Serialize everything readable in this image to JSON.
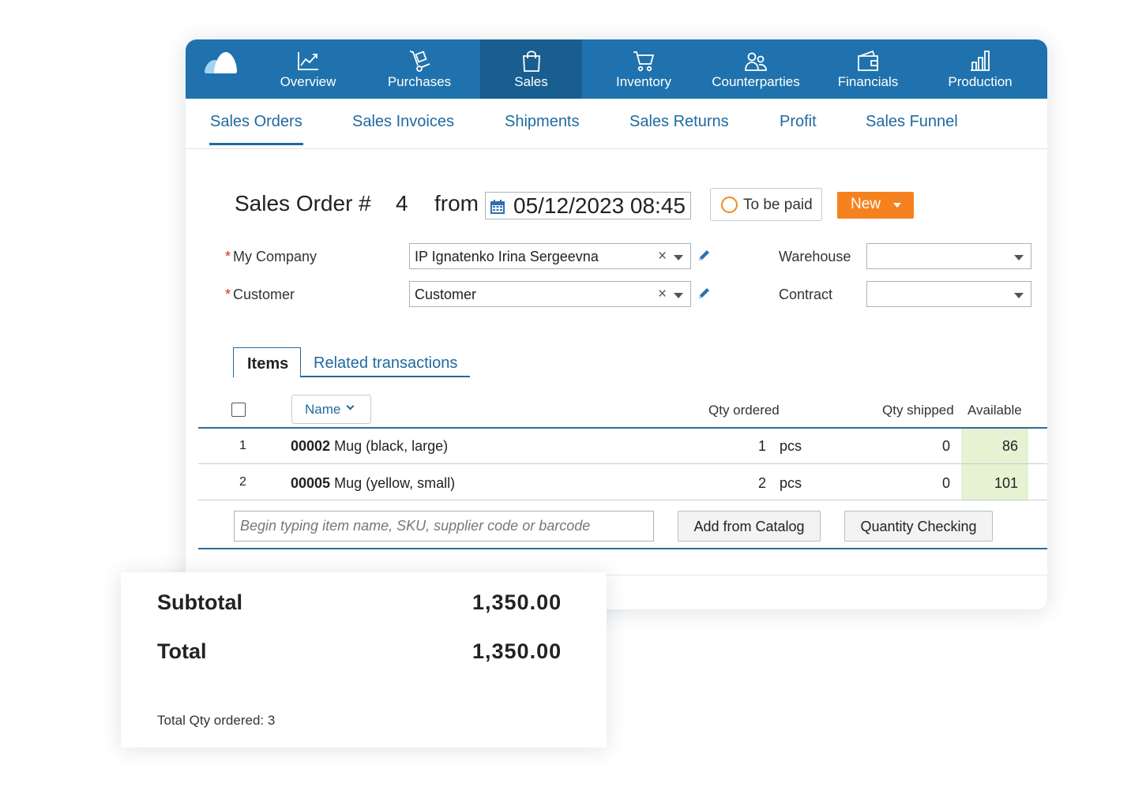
{
  "nav": {
    "items": [
      {
        "label": "Overview",
        "icon": "chart-line-icon"
      },
      {
        "label": "Purchases",
        "icon": "hand-truck-icon"
      },
      {
        "label": "Sales",
        "icon": "shopping-bag-icon",
        "active": true
      },
      {
        "label": "Inventory",
        "icon": "cart-icon"
      },
      {
        "label": "Counterparties",
        "icon": "users-icon"
      },
      {
        "label": "Financials",
        "icon": "wallet-icon"
      },
      {
        "label": "Production",
        "icon": "factory-icon"
      }
    ]
  },
  "subnav": {
    "items": [
      "Sales Orders",
      "Sales Invoices",
      "Shipments",
      "Sales Returns",
      "Profit",
      "Sales Funnel"
    ],
    "active": "Sales Orders"
  },
  "order": {
    "title": "Sales Order #",
    "number": "4",
    "from_label": "from",
    "date": "05/12/2023 08:45",
    "status_label": "To be paid",
    "state_label": "New"
  },
  "form": {
    "required_mark": "*",
    "my_company_label": "My Company",
    "my_company_value": "IP Ignatenko Irina Sergeevna",
    "customer_label": "Customer",
    "customer_value": "Customer",
    "warehouse_label": "Warehouse",
    "warehouse_value": "",
    "contract_label": "Contract",
    "contract_value": ""
  },
  "tabs": {
    "items": "Items",
    "related": "Related transactions"
  },
  "table": {
    "headers": {
      "name": "Name",
      "qty_ordered": "Qty ordered",
      "qty_shipped": "Qty shipped",
      "available": "Available"
    },
    "rows": [
      {
        "n": "1",
        "code": "00002",
        "name": "Mug (black, large)",
        "qty": "1",
        "unit": "pcs",
        "shipped": "0",
        "available": "86"
      },
      {
        "n": "2",
        "code": "00005",
        "name": "Mug (yellow, small)",
        "qty": "2",
        "unit": "pcs",
        "shipped": "0",
        "available": "101"
      }
    ],
    "search_placeholder": "Begin typing item name, SKU, supplier code or barcode",
    "add_from_catalog": "Add from Catalog",
    "quantity_checking": "Quantity Checking"
  },
  "summary": {
    "subtotal_label": "Subtotal",
    "subtotal_value": "1,350.00",
    "total_label": "Total",
    "total_value": "1,350.00",
    "total_qty_label": "Total Qty ordered: 3"
  },
  "colors": {
    "nav_bg": "#1f72ad",
    "nav_active": "#195e90",
    "link": "#1f6a9f",
    "accent_orange": "#f5821f",
    "available_bg": "#e6f2d2"
  }
}
